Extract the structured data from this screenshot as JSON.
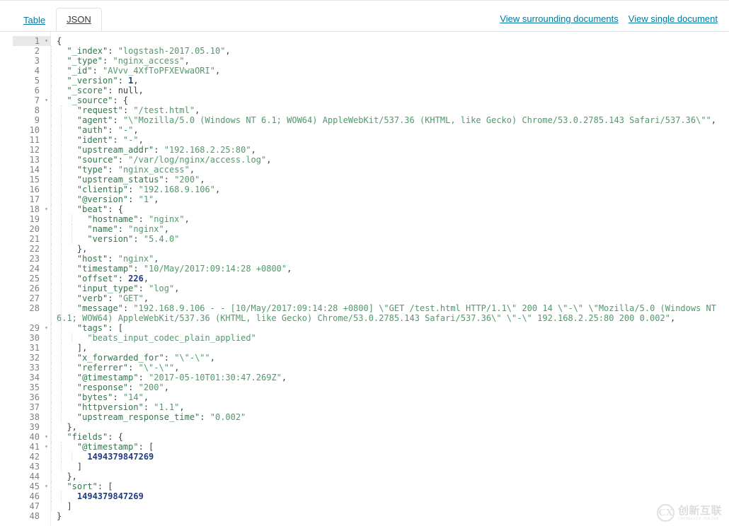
{
  "header": {
    "tabs": [
      {
        "label": "Table",
        "active": false,
        "name": "tab-table"
      },
      {
        "label": "JSON",
        "active": true,
        "name": "tab-json"
      }
    ],
    "links": [
      {
        "label": "View surrounding documents",
        "name": "view-surrounding-documents-link"
      },
      {
        "label": "View single document",
        "name": "view-single-document-link"
      }
    ]
  },
  "editor": {
    "active_line": 1,
    "total_lines": 48,
    "fold_icon": "chevron-down-icon",
    "fold_lines": [
      1,
      7,
      18,
      29,
      40,
      41,
      45
    ],
    "colors": {
      "key": "#2a7a48",
      "string": "#4e9a6a",
      "number": "#1f3c88",
      "punctuation": "#3b4044",
      "line_number": "#7b8287",
      "active_line_bg": "#e8e8e8",
      "link": "#0079a5"
    },
    "lines": [
      {
        "n": 1,
        "indent": 0,
        "fold": true,
        "tokens": [
          {
            "t": "p",
            "v": "{"
          }
        ]
      },
      {
        "n": 2,
        "indent": 1,
        "tokens": [
          {
            "t": "k",
            "v": "\"_index\""
          },
          {
            "t": "p",
            "v": ": "
          },
          {
            "t": "s",
            "v": "\"logstash-2017.05.10\""
          },
          {
            "t": "p",
            "v": ","
          }
        ]
      },
      {
        "n": 3,
        "indent": 1,
        "tokens": [
          {
            "t": "k",
            "v": "\"_type\""
          },
          {
            "t": "p",
            "v": ": "
          },
          {
            "t": "s",
            "v": "\"nginx_access\""
          },
          {
            "t": "p",
            "v": ","
          }
        ]
      },
      {
        "n": 4,
        "indent": 1,
        "tokens": [
          {
            "t": "k",
            "v": "\"_id\""
          },
          {
            "t": "p",
            "v": ": "
          },
          {
            "t": "s",
            "v": "\"AVvv_4XfToPFXEVwaORI\""
          },
          {
            "t": "p",
            "v": ","
          }
        ]
      },
      {
        "n": 5,
        "indent": 1,
        "tokens": [
          {
            "t": "k",
            "v": "\"_version\""
          },
          {
            "t": "p",
            "v": ": "
          },
          {
            "t": "n",
            "v": "1"
          },
          {
            "t": "p",
            "v": ","
          }
        ]
      },
      {
        "n": 6,
        "indent": 1,
        "tokens": [
          {
            "t": "k",
            "v": "\"_score\""
          },
          {
            "t": "p",
            "v": ": "
          },
          {
            "t": "nul",
            "v": "null"
          },
          {
            "t": "p",
            "v": ","
          }
        ]
      },
      {
        "n": 7,
        "indent": 1,
        "fold": true,
        "tokens": [
          {
            "t": "k",
            "v": "\"_source\""
          },
          {
            "t": "p",
            "v": ": {"
          }
        ]
      },
      {
        "n": 8,
        "indent": 2,
        "tokens": [
          {
            "t": "k",
            "v": "\"request\""
          },
          {
            "t": "p",
            "v": ": "
          },
          {
            "t": "s",
            "v": "\"/test.html\""
          },
          {
            "t": "p",
            "v": ","
          }
        ]
      },
      {
        "n": 9,
        "indent": 2,
        "tokens": [
          {
            "t": "k",
            "v": "\"agent\""
          },
          {
            "t": "p",
            "v": ": "
          },
          {
            "t": "s",
            "v": "\"\\\"Mozilla/5.0 (Windows NT 6.1; WOW64) AppleWebKit/537.36 (KHTML, like Gecko) Chrome/53.0.2785.143 Safari/537.36\\\"\""
          },
          {
            "t": "p",
            "v": ","
          }
        ]
      },
      {
        "n": 10,
        "indent": 2,
        "tokens": [
          {
            "t": "k",
            "v": "\"auth\""
          },
          {
            "t": "p",
            "v": ": "
          },
          {
            "t": "s",
            "v": "\"-\""
          },
          {
            "t": "p",
            "v": ","
          }
        ]
      },
      {
        "n": 11,
        "indent": 2,
        "tokens": [
          {
            "t": "k",
            "v": "\"ident\""
          },
          {
            "t": "p",
            "v": ": "
          },
          {
            "t": "s",
            "v": "\"-\""
          },
          {
            "t": "p",
            "v": ","
          }
        ]
      },
      {
        "n": 12,
        "indent": 2,
        "tokens": [
          {
            "t": "k",
            "v": "\"upstream_addr\""
          },
          {
            "t": "p",
            "v": ": "
          },
          {
            "t": "s",
            "v": "\"192.168.2.25:80\""
          },
          {
            "t": "p",
            "v": ","
          }
        ]
      },
      {
        "n": 13,
        "indent": 2,
        "tokens": [
          {
            "t": "k",
            "v": "\"source\""
          },
          {
            "t": "p",
            "v": ": "
          },
          {
            "t": "s",
            "v": "\"/var/log/nginx/access.log\""
          },
          {
            "t": "p",
            "v": ","
          }
        ]
      },
      {
        "n": 14,
        "indent": 2,
        "tokens": [
          {
            "t": "k",
            "v": "\"type\""
          },
          {
            "t": "p",
            "v": ": "
          },
          {
            "t": "s",
            "v": "\"nginx_access\""
          },
          {
            "t": "p",
            "v": ","
          }
        ]
      },
      {
        "n": 15,
        "indent": 2,
        "tokens": [
          {
            "t": "k",
            "v": "\"upstream_status\""
          },
          {
            "t": "p",
            "v": ": "
          },
          {
            "t": "s",
            "v": "\"200\""
          },
          {
            "t": "p",
            "v": ","
          }
        ]
      },
      {
        "n": 16,
        "indent": 2,
        "tokens": [
          {
            "t": "k",
            "v": "\"clientip\""
          },
          {
            "t": "p",
            "v": ": "
          },
          {
            "t": "s",
            "v": "\"192.168.9.106\""
          },
          {
            "t": "p",
            "v": ","
          }
        ]
      },
      {
        "n": 17,
        "indent": 2,
        "tokens": [
          {
            "t": "k",
            "v": "\"@version\""
          },
          {
            "t": "p",
            "v": ": "
          },
          {
            "t": "s",
            "v": "\"1\""
          },
          {
            "t": "p",
            "v": ","
          }
        ]
      },
      {
        "n": 18,
        "indent": 2,
        "fold": true,
        "tokens": [
          {
            "t": "k",
            "v": "\"beat\""
          },
          {
            "t": "p",
            "v": ": {"
          }
        ]
      },
      {
        "n": 19,
        "indent": 3,
        "tokens": [
          {
            "t": "k",
            "v": "\"hostname\""
          },
          {
            "t": "p",
            "v": ": "
          },
          {
            "t": "s",
            "v": "\"nginx\""
          },
          {
            "t": "p",
            "v": ","
          }
        ]
      },
      {
        "n": 20,
        "indent": 3,
        "tokens": [
          {
            "t": "k",
            "v": "\"name\""
          },
          {
            "t": "p",
            "v": ": "
          },
          {
            "t": "s",
            "v": "\"nginx\""
          },
          {
            "t": "p",
            "v": ","
          }
        ]
      },
      {
        "n": 21,
        "indent": 3,
        "tokens": [
          {
            "t": "k",
            "v": "\"version\""
          },
          {
            "t": "p",
            "v": ": "
          },
          {
            "t": "s",
            "v": "\"5.4.0\""
          }
        ]
      },
      {
        "n": 22,
        "indent": 2,
        "tokens": [
          {
            "t": "p",
            "v": "},"
          }
        ]
      },
      {
        "n": 23,
        "indent": 2,
        "tokens": [
          {
            "t": "k",
            "v": "\"host\""
          },
          {
            "t": "p",
            "v": ": "
          },
          {
            "t": "s",
            "v": "\"nginx\""
          },
          {
            "t": "p",
            "v": ","
          }
        ]
      },
      {
        "n": 24,
        "indent": 2,
        "tokens": [
          {
            "t": "k",
            "v": "\"timestamp\""
          },
          {
            "t": "p",
            "v": ": "
          },
          {
            "t": "s",
            "v": "\"10/May/2017:09:14:28 +0800\""
          },
          {
            "t": "p",
            "v": ","
          }
        ]
      },
      {
        "n": 25,
        "indent": 2,
        "tokens": [
          {
            "t": "k",
            "v": "\"offset\""
          },
          {
            "t": "p",
            "v": ": "
          },
          {
            "t": "n",
            "v": "226"
          },
          {
            "t": "p",
            "v": ","
          }
        ]
      },
      {
        "n": 26,
        "indent": 2,
        "tokens": [
          {
            "t": "k",
            "v": "\"input_type\""
          },
          {
            "t": "p",
            "v": ": "
          },
          {
            "t": "s",
            "v": "\"log\""
          },
          {
            "t": "p",
            "v": ","
          }
        ]
      },
      {
        "n": 27,
        "indent": 2,
        "tokens": [
          {
            "t": "k",
            "v": "\"verb\""
          },
          {
            "t": "p",
            "v": ": "
          },
          {
            "t": "s",
            "v": "\"GET\""
          },
          {
            "t": "p",
            "v": ","
          }
        ]
      },
      {
        "n": 28,
        "indent": 2,
        "tokens": [
          {
            "t": "k",
            "v": "\"message\""
          },
          {
            "t": "p",
            "v": ": "
          },
          {
            "t": "s",
            "v": "\"192.168.9.106 - - [10/May/2017:09:14:28 +0800] \\\"GET /test.html HTTP/1.1\\\" 200 14 \\\"-\\\" \\\"Mozilla/5.0 (Windows NT 6.1; WOW64) AppleWebKit/537.36 (KHTML, like Gecko) Chrome/53.0.2785.143 Safari/537.36\\\" \\\"-\\\" 192.168.2.25:80 200 0.002\""
          },
          {
            "t": "p",
            "v": ","
          }
        ]
      },
      {
        "n": 29,
        "indent": 2,
        "fold": true,
        "tokens": [
          {
            "t": "k",
            "v": "\"tags\""
          },
          {
            "t": "p",
            "v": ": ["
          }
        ]
      },
      {
        "n": 30,
        "indent": 3,
        "tokens": [
          {
            "t": "s",
            "v": "\"beats_input_codec_plain_applied\""
          }
        ]
      },
      {
        "n": 31,
        "indent": 2,
        "tokens": [
          {
            "t": "p",
            "v": "],"
          }
        ]
      },
      {
        "n": 32,
        "indent": 2,
        "tokens": [
          {
            "t": "k",
            "v": "\"x_forwarded_for\""
          },
          {
            "t": "p",
            "v": ": "
          },
          {
            "t": "s",
            "v": "\"\\\"-\\\"\""
          },
          {
            "t": "p",
            "v": ","
          }
        ]
      },
      {
        "n": 33,
        "indent": 2,
        "tokens": [
          {
            "t": "k",
            "v": "\"referrer\""
          },
          {
            "t": "p",
            "v": ": "
          },
          {
            "t": "s",
            "v": "\"\\\"-\\\"\""
          },
          {
            "t": "p",
            "v": ","
          }
        ]
      },
      {
        "n": 34,
        "indent": 2,
        "tokens": [
          {
            "t": "k",
            "v": "\"@timestamp\""
          },
          {
            "t": "p",
            "v": ": "
          },
          {
            "t": "s",
            "v": "\"2017-05-10T01:30:47.269Z\""
          },
          {
            "t": "p",
            "v": ","
          }
        ]
      },
      {
        "n": 35,
        "indent": 2,
        "tokens": [
          {
            "t": "k",
            "v": "\"response\""
          },
          {
            "t": "p",
            "v": ": "
          },
          {
            "t": "s",
            "v": "\"200\""
          },
          {
            "t": "p",
            "v": ","
          }
        ]
      },
      {
        "n": 36,
        "indent": 2,
        "tokens": [
          {
            "t": "k",
            "v": "\"bytes\""
          },
          {
            "t": "p",
            "v": ": "
          },
          {
            "t": "s",
            "v": "\"14\""
          },
          {
            "t": "p",
            "v": ","
          }
        ]
      },
      {
        "n": 37,
        "indent": 2,
        "tokens": [
          {
            "t": "k",
            "v": "\"httpversion\""
          },
          {
            "t": "p",
            "v": ": "
          },
          {
            "t": "s",
            "v": "\"1.1\""
          },
          {
            "t": "p",
            "v": ","
          }
        ]
      },
      {
        "n": 38,
        "indent": 2,
        "tokens": [
          {
            "t": "k",
            "v": "\"upstream_response_time\""
          },
          {
            "t": "p",
            "v": ": "
          },
          {
            "t": "s",
            "v": "\"0.002\""
          }
        ]
      },
      {
        "n": 39,
        "indent": 1,
        "tokens": [
          {
            "t": "p",
            "v": "},"
          }
        ]
      },
      {
        "n": 40,
        "indent": 1,
        "fold": true,
        "tokens": [
          {
            "t": "k",
            "v": "\"fields\""
          },
          {
            "t": "p",
            "v": ": {"
          }
        ]
      },
      {
        "n": 41,
        "indent": 2,
        "fold": true,
        "tokens": [
          {
            "t": "k",
            "v": "\"@timestamp\""
          },
          {
            "t": "p",
            "v": ": ["
          }
        ]
      },
      {
        "n": 42,
        "indent": 3,
        "tokens": [
          {
            "t": "n",
            "v": "1494379847269"
          }
        ]
      },
      {
        "n": 43,
        "indent": 2,
        "tokens": [
          {
            "t": "p",
            "v": "]"
          }
        ]
      },
      {
        "n": 44,
        "indent": 1,
        "tokens": [
          {
            "t": "p",
            "v": "},"
          }
        ]
      },
      {
        "n": 45,
        "indent": 1,
        "fold": true,
        "tokens": [
          {
            "t": "k",
            "v": "\"sort\""
          },
          {
            "t": "p",
            "v": ": ["
          }
        ]
      },
      {
        "n": 46,
        "indent": 2,
        "tokens": [
          {
            "t": "n",
            "v": "1494379847269"
          }
        ]
      },
      {
        "n": 47,
        "indent": 1,
        "tokens": [
          {
            "t": "p",
            "v": "]"
          }
        ]
      },
      {
        "n": 48,
        "indent": 0,
        "tokens": [
          {
            "t": "p",
            "v": "}"
          }
        ]
      }
    ]
  },
  "watermark": {
    "mark": "CX",
    "cn": "创新互联",
    "en": "CHUANGXIN HULIAN"
  }
}
